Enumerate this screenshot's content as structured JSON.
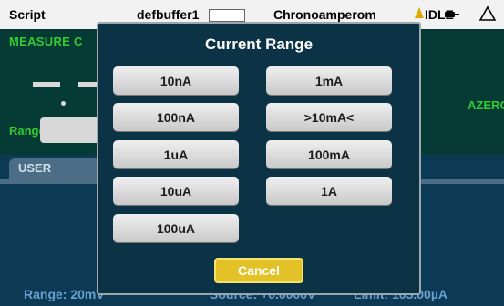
{
  "topbar": {
    "menu_label": "Script",
    "buffer_name": "defbuffer1",
    "function_name": "Chronoamperom",
    "status": "IDLE"
  },
  "measure": {
    "label": "MEASURE C",
    "azero_label": "AZERO",
    "range_label": "Range"
  },
  "user_panel": {
    "tab_label": "USER"
  },
  "bottombar": {
    "range_text": "Range: 20mV",
    "source_text": "Source: +0.0000V",
    "limit_text": "Limit: 105.00µA"
  },
  "dialog": {
    "title": "Current Range",
    "options": [
      "10nA",
      "1mA",
      "100nA",
      ">10mA<",
      "1uA",
      "100mA",
      "10uA",
      "1A",
      "100uA"
    ],
    "cancel_label": "Cancel"
  },
  "colors": {
    "accent_green": "#33cc33",
    "dialog_bg": "#0b3345",
    "cancel_yellow": "#e2c226"
  },
  "icons": [
    "trigger-icon",
    "plug-icon",
    "warning-icon"
  ]
}
